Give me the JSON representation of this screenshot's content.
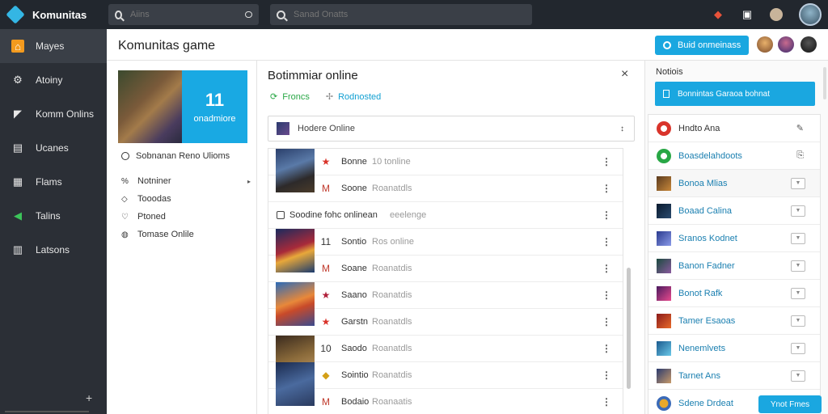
{
  "app": {
    "title": "Komunitas"
  },
  "topbar": {
    "search1_placeholder": "Aiins",
    "search2_placeholder": "Sanad Onatts",
    "icons": [
      "gamepad-icon",
      "briefcase-icon",
      "user-icon",
      "profile-avatar"
    ]
  },
  "sidebar": {
    "items": [
      {
        "label": "Mayes",
        "icon": "home-icon",
        "active": true
      },
      {
        "label": "Atoiny",
        "icon": "gear-icon"
      },
      {
        "label": "Komm Onlins",
        "icon": "megaphone-icon"
      },
      {
        "label": "Ucanes",
        "icon": "document-icon"
      },
      {
        "label": "Flams",
        "icon": "grid-icon"
      },
      {
        "label": "Talins",
        "icon": "send-icon"
      },
      {
        "label": "Latsons",
        "icon": "table-icon"
      }
    ],
    "plus": "+"
  },
  "header": {
    "page_title": "Komunitas game",
    "action_label": "Buid onmeinass"
  },
  "left": {
    "banner_number": "11",
    "banner_sub": "onadmiore",
    "link": "Sobnanan Reno Ulioms",
    "list": [
      {
        "label": "Notniner",
        "icon": "%",
        "caret": "▸"
      },
      {
        "label": "Tooodas",
        "icon": "◇"
      },
      {
        "label": "Ptoned",
        "icon": "♡"
      },
      {
        "label": "Tomase Onlile",
        "icon": "◍"
      }
    ]
  },
  "middle": {
    "title": "Botimmiar online",
    "close": "×",
    "tabs": [
      {
        "label": "Froncs",
        "icon": "⟳"
      },
      {
        "label": "Rodnosted",
        "icon": "✢"
      }
    ],
    "select_label": "Hodere Online",
    "select_arrow": "↕",
    "rows": [
      {
        "type": "item",
        "badge": "★",
        "badge_color": "#d9342b",
        "name": "Bonne",
        "status": "10 tonline",
        "thumb": "linear-gradient(160deg,#2a3f6b,#5a7aa8 40%,#2d2a2a 70%,#4a3b2a)"
      },
      {
        "type": "item",
        "badge": "M",
        "badge_color": "#c0392b",
        "name": "Soone",
        "status": "Roanatdls",
        "thumb": ""
      },
      {
        "type": "section",
        "name": "Soodine fohc onlinean",
        "status": "eeelenge"
      },
      {
        "type": "item",
        "badge": "11",
        "badge_color": "#333333",
        "name": "Sontio",
        "status": "Ros online",
        "thumb": "linear-gradient(160deg,#1a2a5e,#a82a3a 45%,#e8a83a 60%,#1a3a6e)"
      },
      {
        "type": "item",
        "badge": "M",
        "badge_color": "#c0392b",
        "name": "Soane",
        "status": "Roanatdis",
        "thumb": ""
      },
      {
        "type": "item",
        "badge": "★",
        "badge_color": "#b0203a",
        "name": "Saano",
        "status": "Roanatdis",
        "thumb": "linear-gradient(160deg,#2a6ab8,#e8883a 45%,#c84a2a 60%,#3a4a8e)"
      },
      {
        "type": "item",
        "badge": "★",
        "badge_color": "#d9342b",
        "name": "Garstn",
        "status": "Roanatdls",
        "thumb": ""
      },
      {
        "type": "item",
        "badge": "10",
        "badge_color": "#333333",
        "name": "Saodo",
        "status": "Roanatdls",
        "thumb": "linear-gradient(160deg,#3a2a1e,#8a6a3a 50%,#c8a06a)"
      },
      {
        "type": "item",
        "badge": "◆",
        "badge_color": "#d4a017",
        "name": "Sointio",
        "status": "Roanatdis",
        "thumb": "linear-gradient(160deg,#1a2a4e,#4a6a9e 50%,#2a3a5e)"
      },
      {
        "type": "item",
        "badge": "M",
        "badge_color": "#c0392b",
        "name": "Bodaio",
        "status": "Roanaatis",
        "thumb": ""
      }
    ]
  },
  "right": {
    "title": "Notiois",
    "button_label": "Bonnintas Garaoa bohnat",
    "items": [
      {
        "name": "Hndto Ana",
        "icon_bg": "radial-gradient(circle,#fff 30%,#d9342b 32%)",
        "control": "edit",
        "first": true
      },
      {
        "name": "Boasdelahdoots",
        "icon_bg": "radial-gradient(circle,#fff 30%,#28a745 32%)",
        "control": "doc"
      },
      {
        "name": "Bonoa Mlias",
        "icon_bg": "linear-gradient(135deg,#5a3a1e,#c8883a)",
        "control": "chk",
        "alt": true
      },
      {
        "name": "Boaad Calina",
        "icon_bg": "linear-gradient(135deg,#0a1a2e,#2a4a6e)",
        "control": "chk"
      },
      {
        "name": "Sranos Kodnet",
        "icon_bg": "linear-gradient(135deg,#2a3a8e,#8a9ae8)",
        "control": "chk"
      },
      {
        "name": "Banon Fadner",
        "icon_bg": "linear-gradient(135deg,#1a4a3e,#8a5a9e)",
        "control": "chk"
      },
      {
        "name": "Bonot Rafk",
        "icon_bg": "linear-gradient(135deg,#4a1a5e,#e84a8e)",
        "control": "chk"
      },
      {
        "name": "Tamer Esaoas",
        "icon_bg": "linear-gradient(135deg,#8a1a1a,#e86a2a)",
        "control": "chk"
      },
      {
        "name": "Nenemlvets",
        "icon_bg": "linear-gradient(135deg,#1a5a8e,#6ac8e8)",
        "control": "chk"
      },
      {
        "name": "Tarnet Ans",
        "icon_bg": "linear-gradient(135deg,#2a3a6e,#c89a6a)",
        "control": "chk"
      },
      {
        "name": "Sdene Drdeat",
        "icon_bg": "radial-gradient(circle,#e8a82a 40%,#3a6ab8 45%)",
        "control": "none"
      }
    ],
    "float_button": "Ynot Fmes"
  },
  "colors": {
    "accent": "#1aa7e0",
    "sidebar": "#2b2f36",
    "topbar": "#22272e",
    "active_nav": "#f39a1e"
  }
}
